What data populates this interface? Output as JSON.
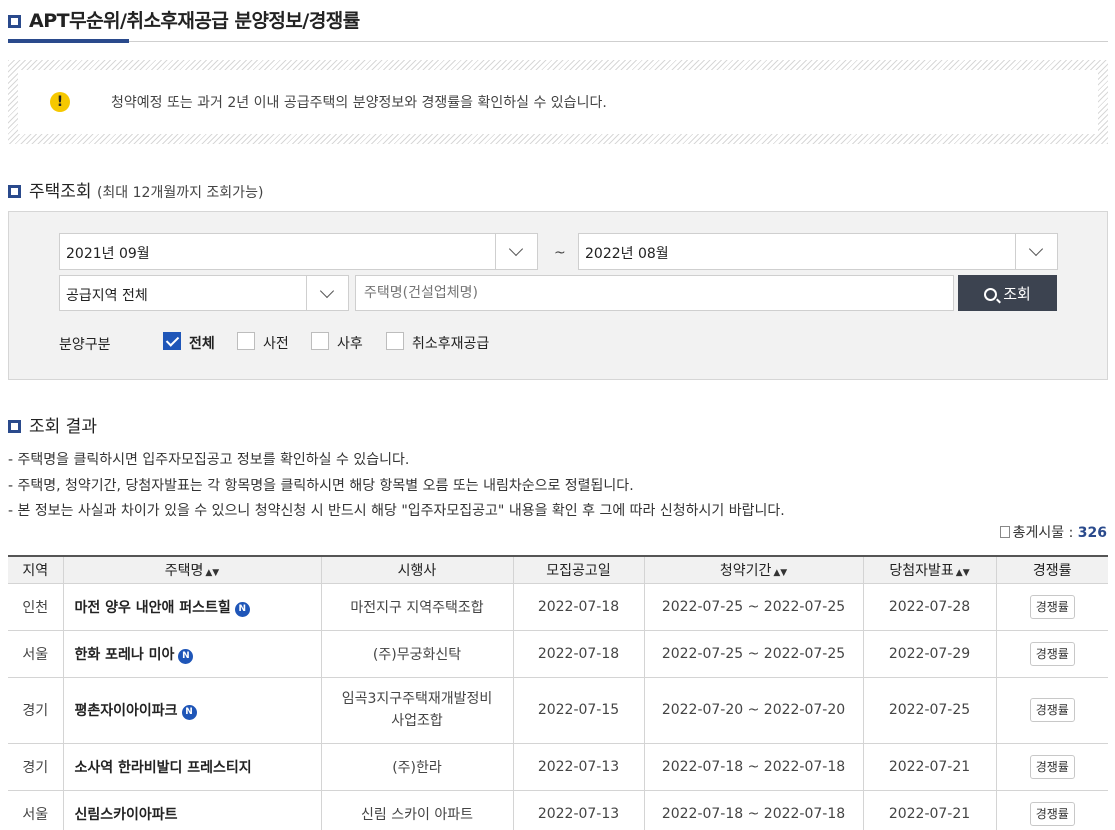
{
  "page": {
    "title": "APT무순위/취소후재공급 분양정보/경쟁률"
  },
  "notice": {
    "text": "청약예정 또는 과거 2년 이내 공급주택의 분양정보와 경쟁률을 확인하실 수 있습니다."
  },
  "search": {
    "title": "주택조회",
    "subtitle": "(최대 12개월까지 조회가능)",
    "start_month": "2021년 09월",
    "range_sep": "~",
    "end_month": "2022년 08월",
    "region": "공급지역 전체",
    "name_placeholder": "주택명(건설업체명)",
    "search_button": "조회",
    "filter_label": "분양구분",
    "filters": [
      {
        "label": "전체",
        "checked": true
      },
      {
        "label": "사전",
        "checked": false
      },
      {
        "label": "사후",
        "checked": false
      },
      {
        "label": "취소후재공급",
        "checked": false
      }
    ]
  },
  "results": {
    "title": "조회 결과",
    "notes": [
      "- 주택명을 클릭하시면 입주자모집공고 정보를 확인하실 수 있습니다.",
      "- 주택명, 청약기간, 당첨자발표는 각 항목명을 클릭하시면 해당 항목별 오름 또는 내림차순으로 정렬됩니다.",
      "- 본 정보는 사실과 차이가 있을 수 있으니 청약신청 시 반드시 해당 \"입주자모집공고\" 내용을 확인 후 그에 따라 신청하시기 바랍니다."
    ],
    "total_label": "총게시물 :",
    "total_count": "326",
    "columns": [
      "지역",
      "주택명",
      "시행사",
      "모집공고일",
      "청약기간",
      "당첨자발표",
      "경쟁률"
    ],
    "sort_glyph": "▲▼",
    "new_badge": "N",
    "rate_button": "경쟁률",
    "rows": [
      {
        "region": "인천",
        "name": "마전 양우 내안애 퍼스트힐",
        "is_new": true,
        "developer": "마전지구 지역주택조합",
        "notice_date": "2022-07-18",
        "period": "2022-07-25 ~ 2022-07-25",
        "announce": "2022-07-28"
      },
      {
        "region": "서울",
        "name": "한화 포레나 미아",
        "is_new": true,
        "developer": "(주)무궁화신탁",
        "notice_date": "2022-07-18",
        "period": "2022-07-25 ~ 2022-07-25",
        "announce": "2022-07-29"
      },
      {
        "region": "경기",
        "name": "평촌자이아이파크",
        "is_new": true,
        "developer": "임곡3지구주택재개발정비사업조합",
        "notice_date": "2022-07-15",
        "period": "2022-07-20 ~ 2022-07-20",
        "announce": "2022-07-25"
      },
      {
        "region": "경기",
        "name": "소사역 한라비발디 프레스티지",
        "is_new": false,
        "developer": "(주)한라",
        "notice_date": "2022-07-13",
        "period": "2022-07-18 ~ 2022-07-18",
        "announce": "2022-07-21"
      },
      {
        "region": "서울",
        "name": "신림스카이아파트",
        "is_new": false,
        "developer": "신림 스카이 아파트",
        "notice_date": "2022-07-13",
        "period": "2022-07-18 ~ 2022-07-18",
        "announce": "2022-07-21"
      }
    ]
  }
}
